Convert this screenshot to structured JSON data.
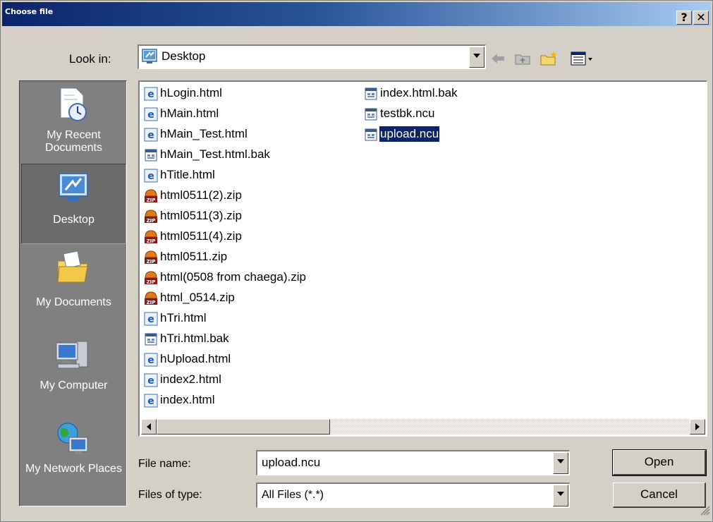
{
  "window": {
    "title": "Choose file"
  },
  "titlebar": {
    "help_label": "?",
    "close_label": "✕"
  },
  "lookin": {
    "label": "Look in:",
    "value": "Desktop"
  },
  "places": [
    {
      "label": "My Recent Documents",
      "icon": "recent-documents-icon"
    },
    {
      "label": "Desktop",
      "icon": "desktop-icon"
    },
    {
      "label": "My Documents",
      "icon": "my-documents-icon"
    },
    {
      "label": "My Computer",
      "icon": "my-computer-icon"
    },
    {
      "label": "My Network Places",
      "icon": "network-places-icon"
    }
  ],
  "files_col1": [
    {
      "name": "hLogin.html",
      "type": "html"
    },
    {
      "name": "hMain.html",
      "type": "html"
    },
    {
      "name": "hMain_Test.html",
      "type": "html"
    },
    {
      "name": "hMain_Test.html.bak",
      "type": "doc"
    },
    {
      "name": "hTitle.html",
      "type": "html"
    },
    {
      "name": "html0511(2).zip",
      "type": "zip"
    },
    {
      "name": "html0511(3).zip",
      "type": "zip"
    },
    {
      "name": "html0511(4).zip",
      "type": "zip"
    },
    {
      "name": "html0511.zip",
      "type": "zip"
    },
    {
      "name": "html(0508 from chaega).zip",
      "type": "zip"
    },
    {
      "name": "html_0514.zip",
      "type": "zip"
    },
    {
      "name": "hTri.html",
      "type": "html"
    },
    {
      "name": "hTri.html.bak",
      "type": "doc"
    },
    {
      "name": "hUpload.html",
      "type": "html"
    },
    {
      "name": "index2.html",
      "type": "html"
    },
    {
      "name": "index.html",
      "type": "html"
    }
  ],
  "files_col2": [
    {
      "name": "index.html.bak",
      "type": "doc"
    },
    {
      "name": "testbk.ncu",
      "type": "doc"
    },
    {
      "name": "upload.ncu",
      "type": "doc",
      "selected": true
    }
  ],
  "filename": {
    "label": "File name:",
    "value": "upload.ncu"
  },
  "filetype": {
    "label": "Files of type:",
    "value": "All Files (*.*)"
  },
  "buttons": {
    "open": "Open",
    "cancel": "Cancel"
  }
}
